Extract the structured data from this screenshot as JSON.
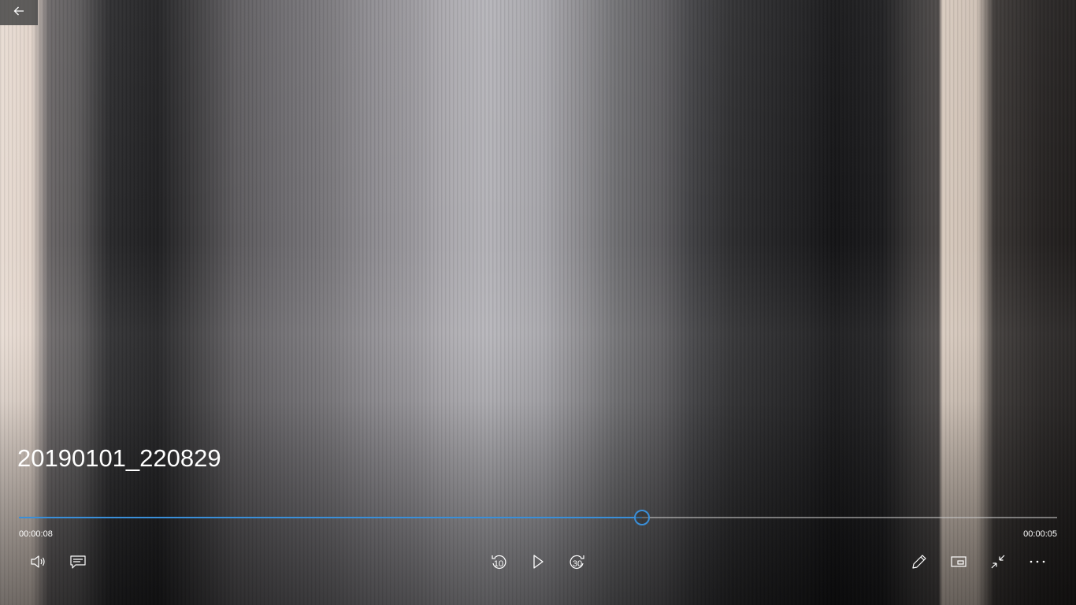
{
  "video": {
    "title": "20190101_220829"
  },
  "playback": {
    "elapsed": "00:00:08",
    "remaining": "00:00:05",
    "progress": 0.6
  },
  "controls": {
    "skip_back_seconds": "10",
    "skip_forward_seconds": "30"
  },
  "colors": {
    "accent": "#3a8fd9",
    "text": "#ffffff"
  },
  "icons": {
    "back": "arrow-left-icon",
    "volume": "volume-icon",
    "subtitles": "subtitles-icon",
    "skip_back": "skip-back-10-icon",
    "play": "play-icon",
    "skip_forward": "skip-forward-30-icon",
    "edit": "pencil-icon",
    "mini_view": "mini-view-icon",
    "exit_fullscreen": "exit-fullscreen-icon",
    "more": "more-icon"
  }
}
